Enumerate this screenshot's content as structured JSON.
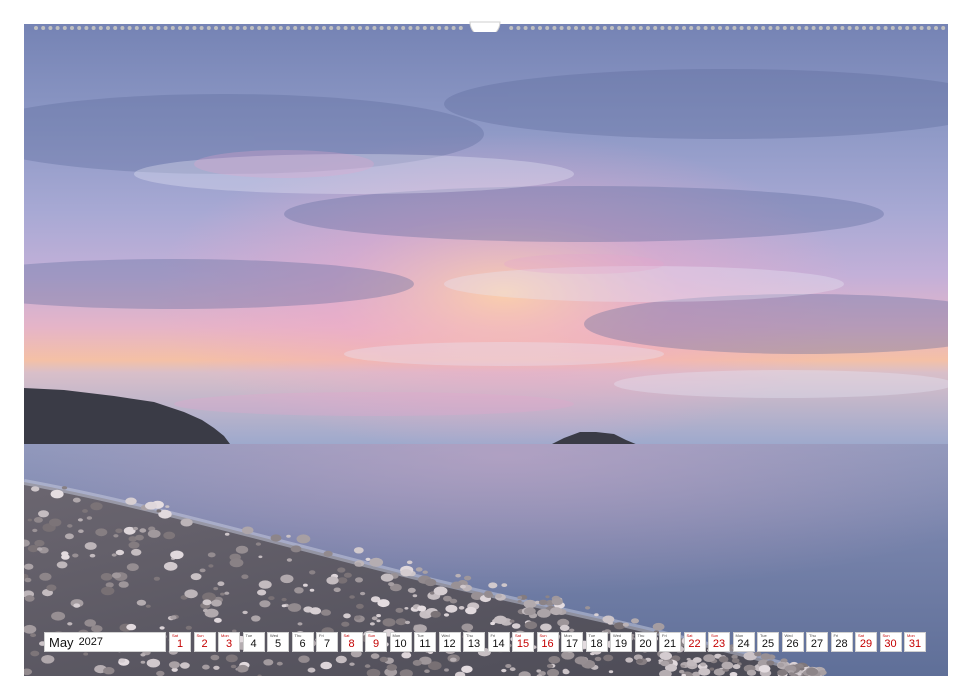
{
  "calendar": {
    "month": "May",
    "year": "2027",
    "days": [
      {
        "n": "1",
        "wd": "Sat",
        "weekend": true
      },
      {
        "n": "2",
        "wd": "Sun",
        "weekend": true
      },
      {
        "n": "3",
        "wd": "Mon",
        "weekend": true
      },
      {
        "n": "4",
        "wd": "Tue",
        "weekend": false
      },
      {
        "n": "5",
        "wd": "Wed",
        "weekend": false
      },
      {
        "n": "6",
        "wd": "Thu",
        "weekend": false
      },
      {
        "n": "7",
        "wd": "Fri",
        "weekend": false
      },
      {
        "n": "8",
        "wd": "Sat",
        "weekend": true
      },
      {
        "n": "9",
        "wd": "Sun",
        "weekend": true
      },
      {
        "n": "10",
        "wd": "Mon",
        "weekend": false
      },
      {
        "n": "11",
        "wd": "Tue",
        "weekend": false
      },
      {
        "n": "12",
        "wd": "Wed",
        "weekend": false
      },
      {
        "n": "13",
        "wd": "Thu",
        "weekend": false
      },
      {
        "n": "14",
        "wd": "Fri",
        "weekend": false
      },
      {
        "n": "15",
        "wd": "Sat",
        "weekend": true
      },
      {
        "n": "16",
        "wd": "Sun",
        "weekend": true
      },
      {
        "n": "17",
        "wd": "Mon",
        "weekend": false
      },
      {
        "n": "18",
        "wd": "Tue",
        "weekend": false
      },
      {
        "n": "19",
        "wd": "Wed",
        "weekend": false
      },
      {
        "n": "20",
        "wd": "Thu",
        "weekend": false
      },
      {
        "n": "21",
        "wd": "Fri",
        "weekend": false
      },
      {
        "n": "22",
        "wd": "Sat",
        "weekend": true
      },
      {
        "n": "23",
        "wd": "Sun",
        "weekend": true
      },
      {
        "n": "24",
        "wd": "Mon",
        "weekend": false
      },
      {
        "n": "25",
        "wd": "Tue",
        "weekend": false
      },
      {
        "n": "26",
        "wd": "Wed",
        "weekend": false
      },
      {
        "n": "27",
        "wd": "Thu",
        "weekend": false
      },
      {
        "n": "28",
        "wd": "Fri",
        "weekend": false
      },
      {
        "n": "29",
        "wd": "Sat",
        "weekend": true
      },
      {
        "n": "30",
        "wd": "Sun",
        "weekend": true
      },
      {
        "n": "31",
        "wd": "Mon",
        "weekend": true
      }
    ]
  },
  "colors": {
    "weekend": "#c40000",
    "sky_top": "#7a86b8",
    "sunset": "#f2b0a0",
    "sea": "#6f7fa6"
  },
  "icons": {
    "binding": "spiral-binding-holes",
    "hanger": "hanger-notch"
  }
}
